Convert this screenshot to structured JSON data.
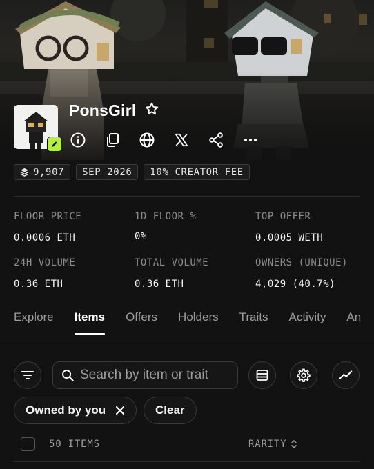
{
  "collection": {
    "name": "PonsGirl",
    "favorite_icon": "star-outline-icon",
    "action_icons": [
      "info-icon",
      "copy-icon",
      "globe-icon",
      "x-logo-icon",
      "share-icon",
      "more-icon"
    ]
  },
  "chips": {
    "supply": "9,907",
    "supply_icon": "layers-icon",
    "date": "SEP 2026",
    "creator_fee": "10% CREATOR FEE"
  },
  "stats": [
    {
      "label": "FLOOR PRICE",
      "value": "0.0006 ETH"
    },
    {
      "label": "1D FLOOR %",
      "value": "0%"
    },
    {
      "label": "TOP OFFER",
      "value": "0.0005 WETH"
    },
    {
      "label": "24H VOLUME",
      "value": "0.36 ETH"
    },
    {
      "label": "TOTAL VOLUME",
      "value": "0.36 ETH"
    },
    {
      "label": "OWNERS (UNIQUE)",
      "value": "4,029 (40.7%)"
    }
  ],
  "tabs": [
    "Explore",
    "Items",
    "Offers",
    "Holders",
    "Traits",
    "Activity",
    "An"
  ],
  "active_tab": "Items",
  "search": {
    "placeholder": "Search by item or trait",
    "value": ""
  },
  "filters": {
    "owned_by_you": "Owned by you",
    "clear": "Clear"
  },
  "list": {
    "count_label": "50 ITEMS",
    "sort_label": "RARITY"
  },
  "colors": {
    "background": "#121212",
    "accent": "#b4f23a",
    "muted_text": "#8c8c8c"
  }
}
